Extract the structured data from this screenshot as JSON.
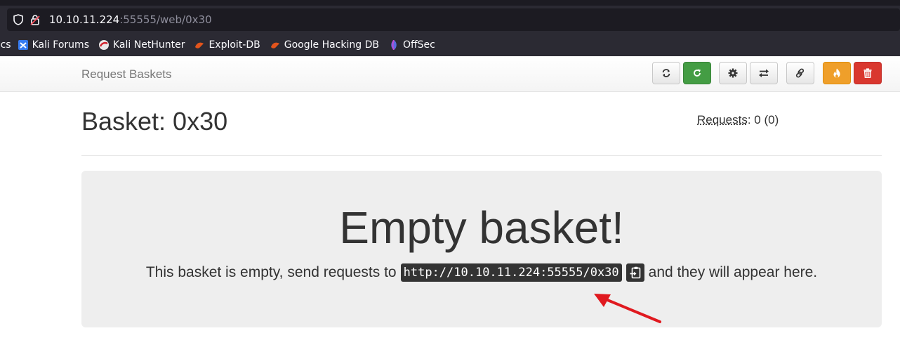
{
  "browser": {
    "url_host": "10.10.11.224",
    "url_rest": ":55555/web/0x30",
    "bookmarks": {
      "cut_label": "ocs",
      "items": [
        "Kali Forums",
        "Kali NetHunter",
        "Exploit-DB",
        "Google Hacking DB",
        "OffSec"
      ]
    }
  },
  "navbar": {
    "brand": "Request Baskets"
  },
  "page": {
    "title": "Basket: 0x30",
    "requests_label": "Requests",
    "requests_value": ": 0 (0)"
  },
  "jumbotron": {
    "heading": "Empty basket!",
    "text_before": "This basket is empty, send requests to",
    "url": "http://10.10.11.224:55555/0x30",
    "text_after": "and they will appear here."
  },
  "colors": {
    "green_button": "#449d44",
    "orange_button": "#ef9f2a",
    "red_button": "#d9372e",
    "annotation_arrow": "#e0191f"
  }
}
